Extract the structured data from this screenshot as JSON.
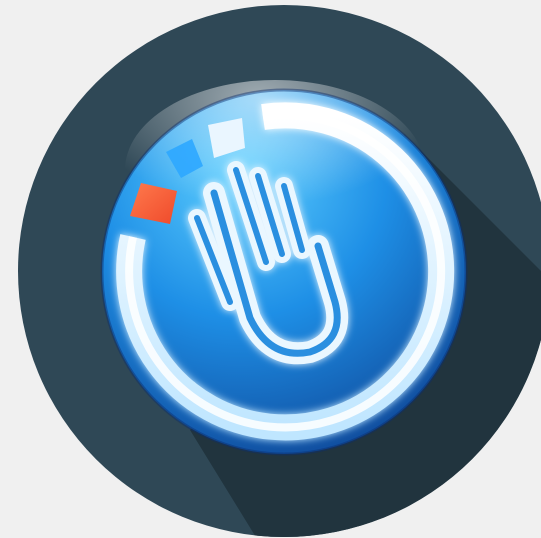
{
  "page_background": "#f0f0f0",
  "app_icon": {
    "icon_name": "touch-hand-power-icon",
    "colors": {
      "circle_background": "#2f4856",
      "long_shadow": "#21343e",
      "button_light": "#5fd0ff",
      "button_mid": "#1e8fe6",
      "button_dark": "#0d3f8f",
      "ring_light": "#ffffff",
      "ring_tint": "#bfe6ff",
      "accent_red": "#ef4a2b",
      "accent_red_light": "#ff7a4d"
    }
  }
}
